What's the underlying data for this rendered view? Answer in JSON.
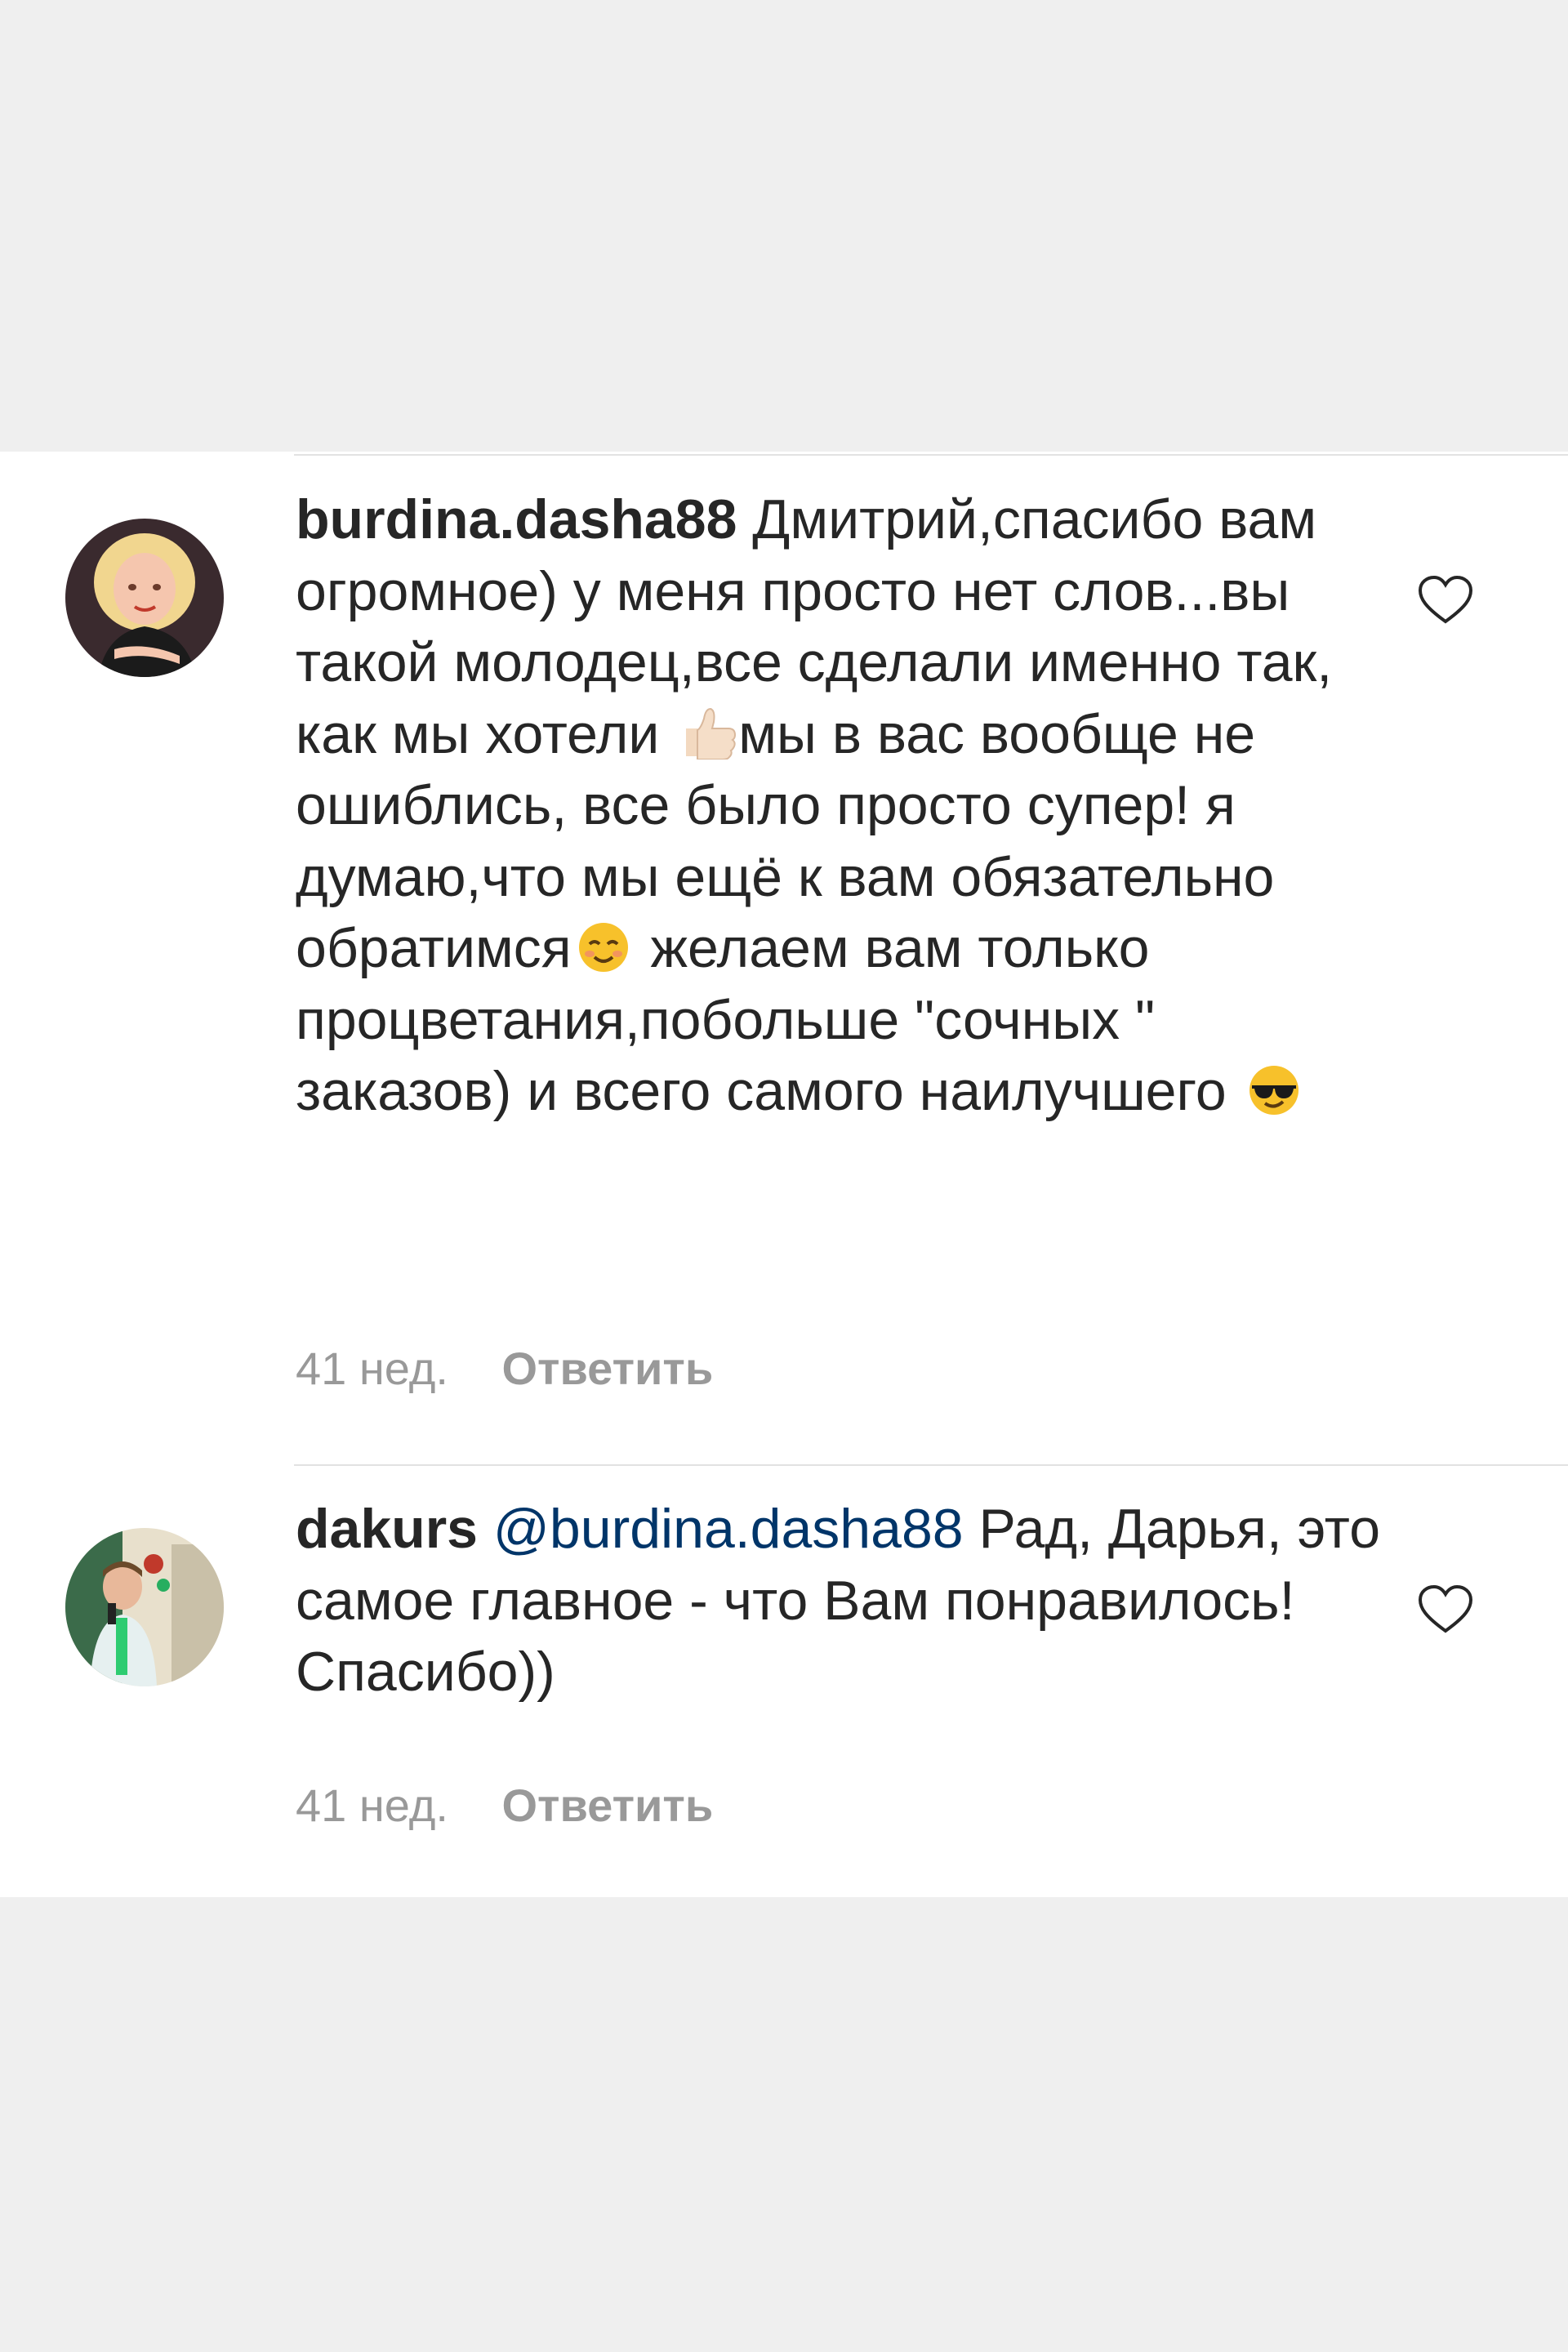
{
  "comments": [
    {
      "username": "burdina.dasha88",
      "text_parts": [
        "Дмитрий,спасибо вам огромное) у меня просто нет слов...вы такой молодец,все сделали именно так, как мы хотели",
        "мы в вас вообще не ошиблись, все было просто супер! я думаю,что мы ещё к вам обязательно обратимся",
        " желаем вам только процветания,побольше \"сочных \" заказов) и всего самого наилучшего"
      ],
      "emojis": [
        "thumbs-up-emoji",
        "smiling-face-emoji",
        "sunglasses-face-emoji"
      ],
      "time": "41 нед.",
      "reply_label": "Ответить",
      "avatar_icon": "user-avatar-woman"
    },
    {
      "username": "dakurs",
      "mention": "@burdina.dasha88",
      "text": "Рад, Дарья, это самое главное - что Вам понравилось! Спасибо))",
      "time": "41 нед.",
      "reply_label": "Ответить",
      "avatar_icon": "user-avatar-man"
    }
  ],
  "colors": {
    "text": "#262626",
    "secondary": "#999999",
    "mention": "#003569",
    "divider": "#e2e2e2",
    "background_gray": "#efefef"
  }
}
